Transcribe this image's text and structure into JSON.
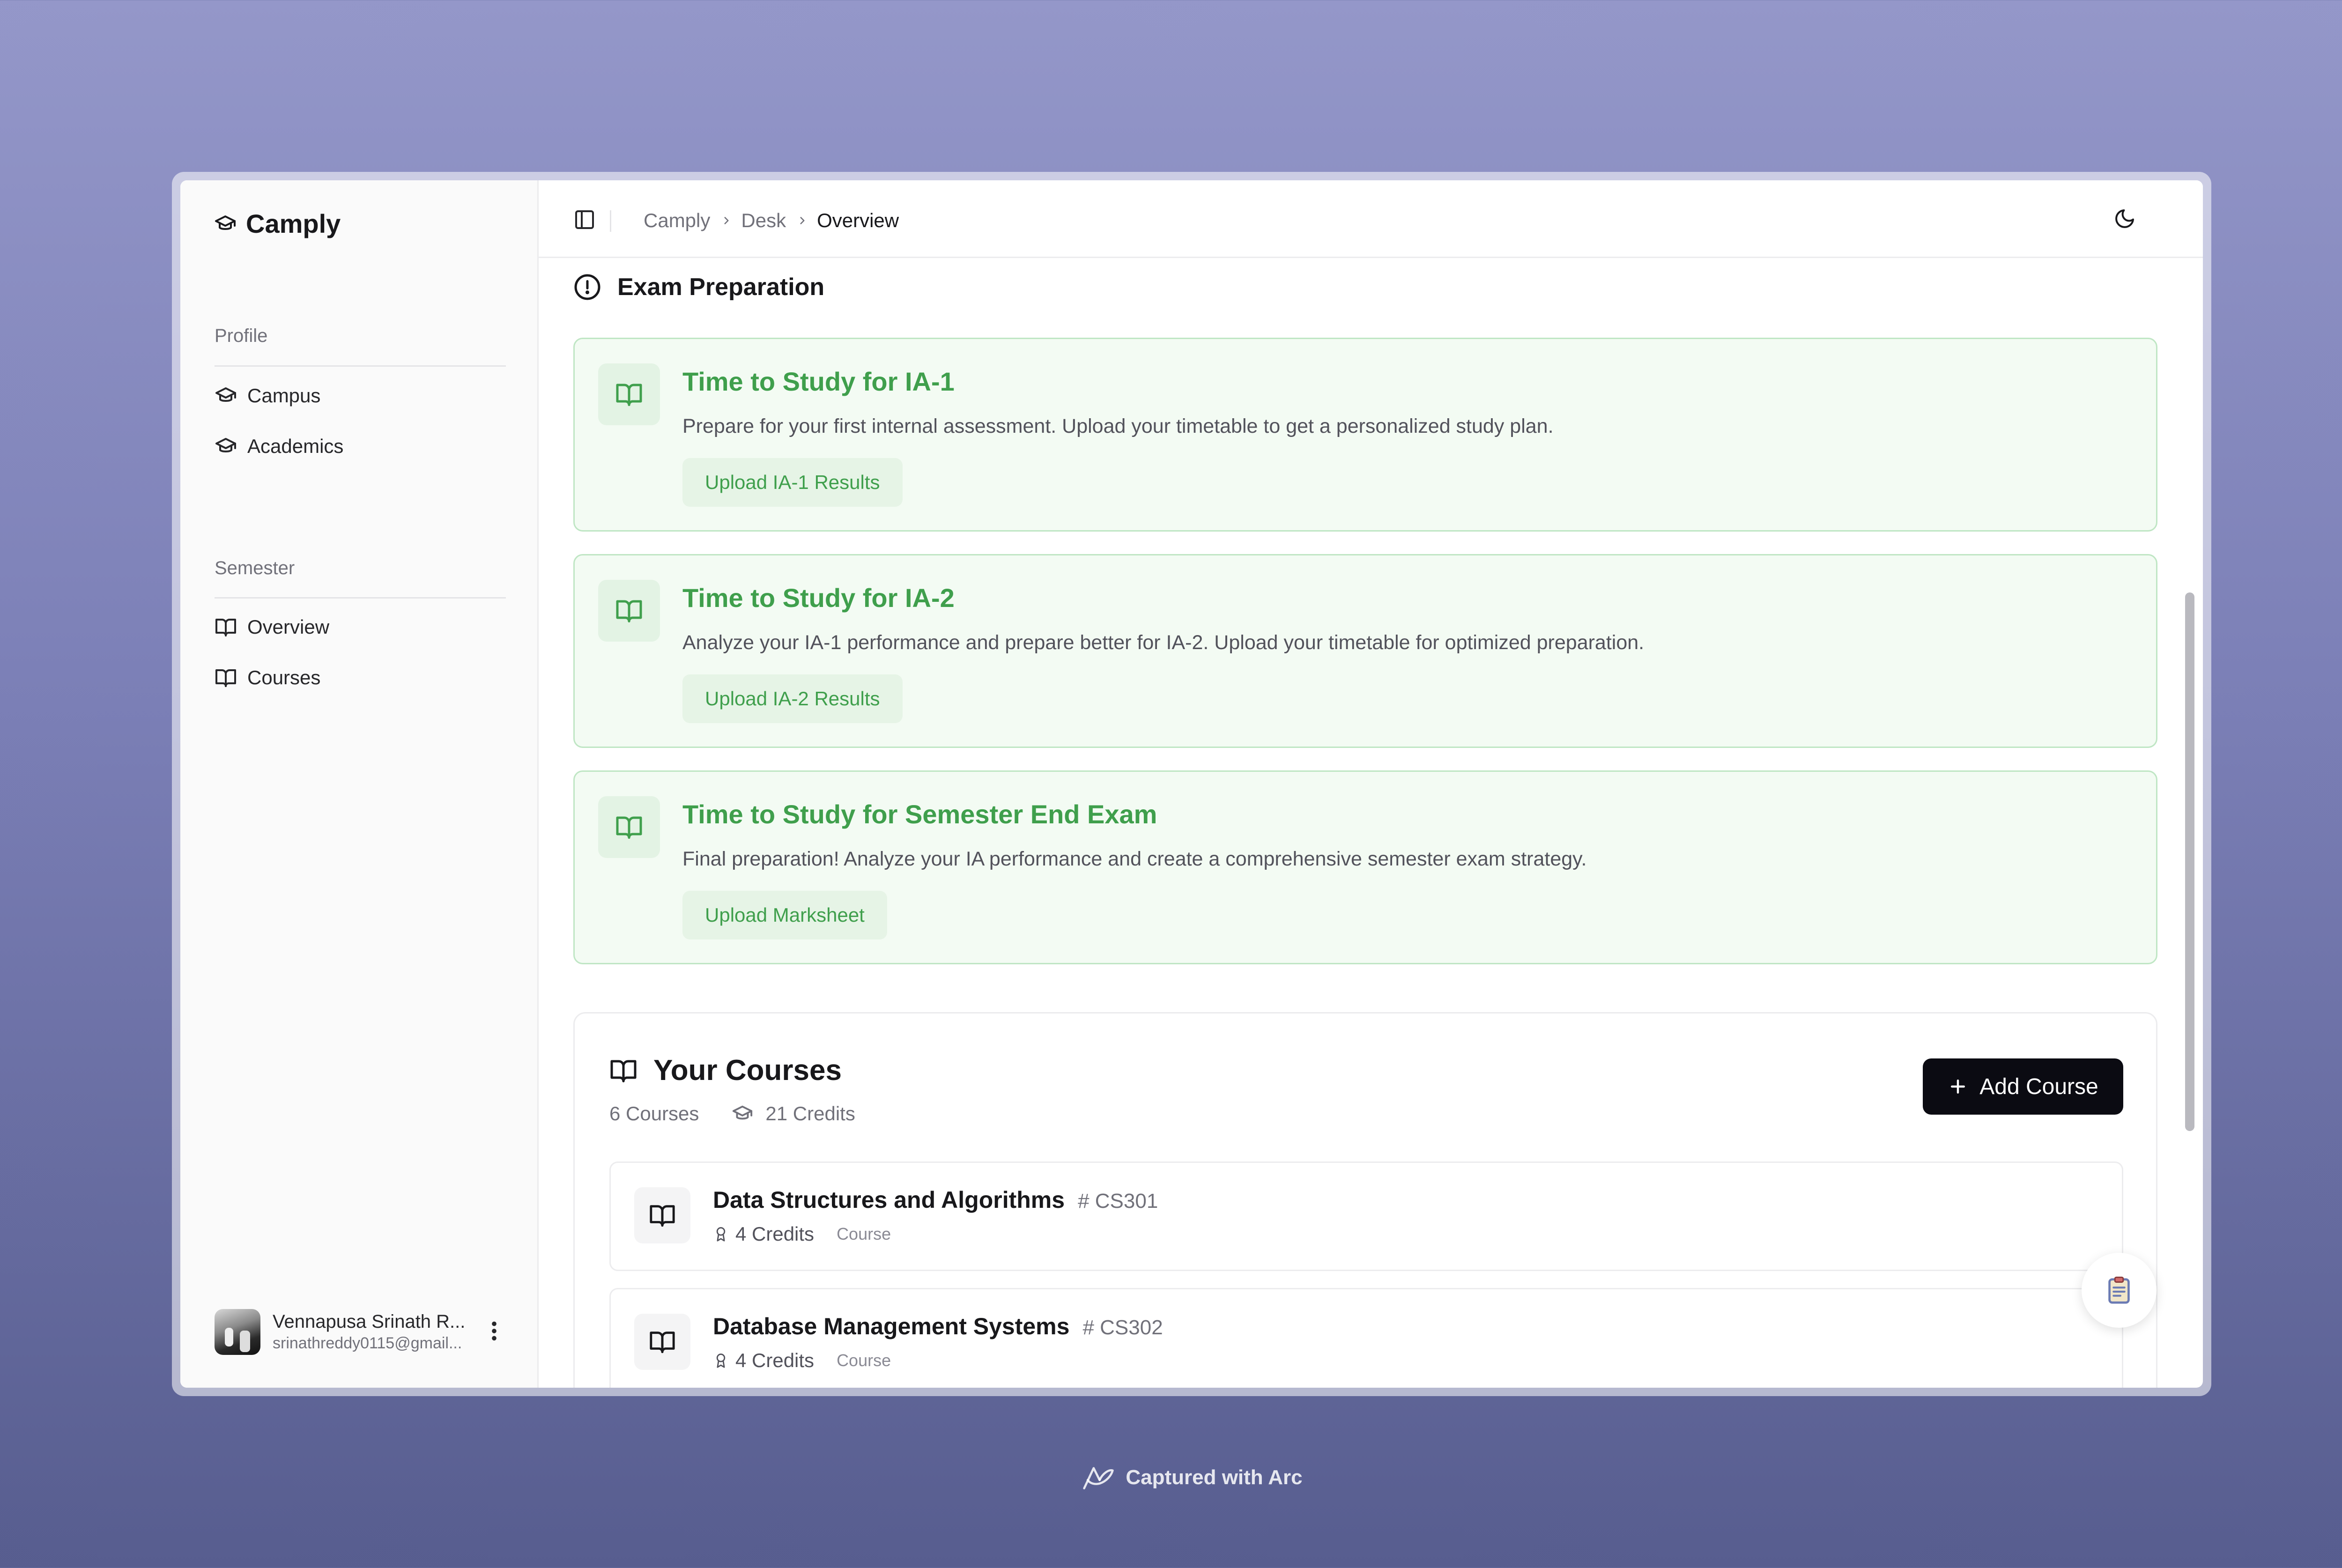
{
  "app": {
    "name": "Camply"
  },
  "sidebar": {
    "groups": [
      {
        "label": "Profile",
        "items": [
          {
            "label": "Campus",
            "icon": "graduation-cap-icon"
          },
          {
            "label": "Academics",
            "icon": "graduation-cap-icon"
          }
        ]
      },
      {
        "label": "Semester",
        "items": [
          {
            "label": "Overview",
            "icon": "book-open-icon"
          },
          {
            "label": "Courses",
            "icon": "book-open-icon"
          }
        ]
      }
    ],
    "user": {
      "name": "Vennapusa Srinath R...",
      "email": "srinathreddy0115@gmail..."
    }
  },
  "topbar": {
    "breadcrumb": [
      "Camply",
      "Desk",
      "Overview"
    ]
  },
  "exam_prep": {
    "title": "Exam Preparation",
    "cards": [
      {
        "title": "Time to Study for IA-1",
        "description": "Prepare for your first internal assessment. Upload your timetable to get a personalized study plan.",
        "button": "Upload IA-1 Results"
      },
      {
        "title": "Time to Study for IA-2",
        "description": "Analyze your IA-1 performance and prepare better for IA-2. Upload your timetable for optimized preparation.",
        "button": "Upload IA-2 Results"
      },
      {
        "title": "Time to Study for Semester End Exam",
        "description": "Final preparation! Analyze your IA performance and create a comprehensive semester exam strategy.",
        "button": "Upload Marksheet"
      }
    ]
  },
  "courses": {
    "title": "Your Courses",
    "count_label": "6 Courses",
    "credits_label": "21 Credits",
    "add_button": "Add Course",
    "items": [
      {
        "name": "Data Structures and Algorithms",
        "code": "# CS301",
        "credits": "4 Credits",
        "type": "Course"
      },
      {
        "name": "Database Management Systems",
        "code": "# CS302",
        "credits": "4 Credits",
        "type": "Course"
      }
    ]
  },
  "footer": {
    "text": "Captured with Arc"
  },
  "colors": {
    "accent_green": "#3f9f4c",
    "card_green_bg": "#f3fbf3",
    "card_green_border": "#bfe6c4",
    "primary_button": "#0b0b12"
  }
}
